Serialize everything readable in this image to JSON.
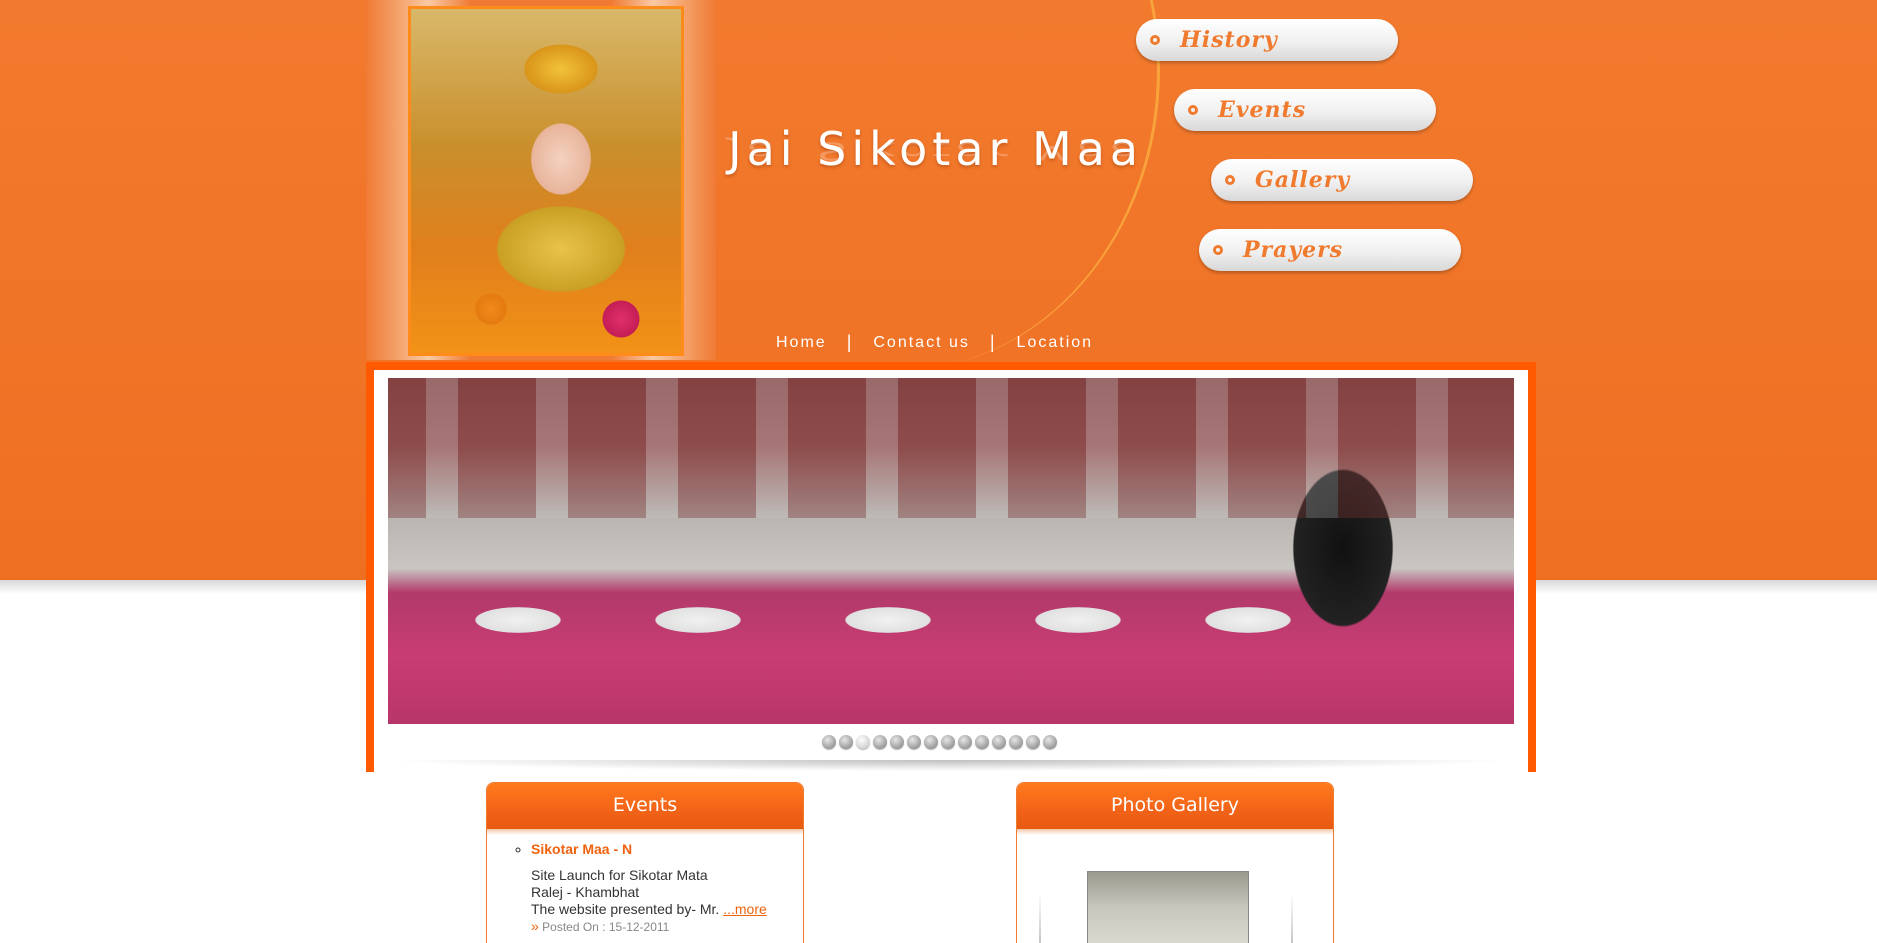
{
  "site": {
    "title": "Jai Sikotar Maa"
  },
  "colors": {
    "brand_orange": "#f07a2e",
    "frame_orange": "#ff5a00"
  },
  "top_links": [
    {
      "label": "Home"
    },
    {
      "label": "Contact us"
    },
    {
      "label": "Location"
    }
  ],
  "separator": "|",
  "nav_pills": [
    {
      "label": "History",
      "icon": "bullet-circle-icon"
    },
    {
      "label": "Events",
      "icon": "bullet-circle-icon"
    },
    {
      "label": "Gallery",
      "icon": "bullet-circle-icon"
    },
    {
      "label": "Prayers",
      "icon": "bullet-circle-icon"
    }
  ],
  "slider": {
    "dot_count": 14,
    "active_index": 2
  },
  "events_box": {
    "heading": "Events",
    "items": [
      {
        "title": "Sikotar Maa - N",
        "line1": "Site Launch for Sikotar Mata",
        "line2": "Ralej - Khambhat",
        "line3": "The website presented by- Mr.",
        "more": "...more",
        "arrow": "»",
        "posted": "Posted On : 15-12-2011"
      }
    ]
  },
  "gallery_box": {
    "heading": "Photo Gallery"
  }
}
